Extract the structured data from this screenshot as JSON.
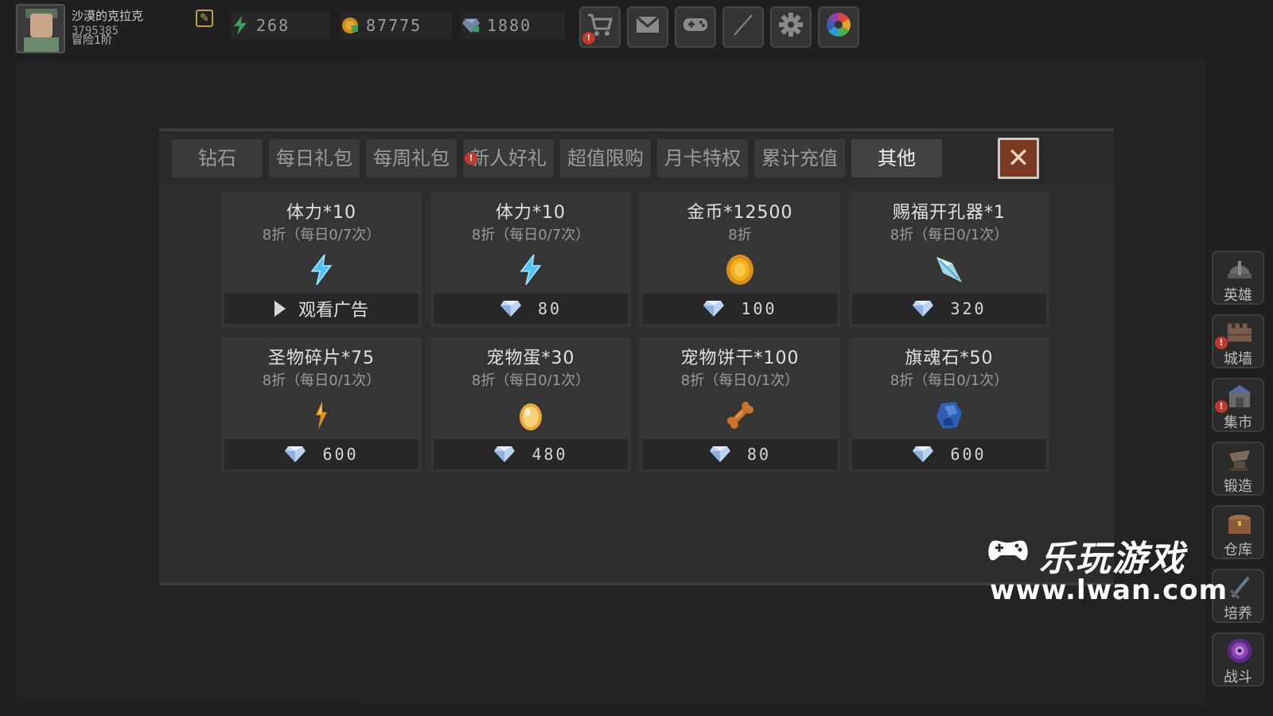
{
  "player": {
    "name": "沙漠的克拉克",
    "id": "3795385",
    "rank": "冒险1阶"
  },
  "resources": [
    {
      "icon": "lightning-icon",
      "value": "268"
    },
    {
      "icon": "gold-coin-icon",
      "value": "87775"
    },
    {
      "icon": "diamond-icon",
      "value": "1880"
    }
  ],
  "top_buttons": [
    {
      "icon": "shop-cart-icon",
      "alert": "!"
    },
    {
      "icon": "mail-icon"
    },
    {
      "icon": "gamepad-icon"
    },
    {
      "icon": "feather-icon"
    },
    {
      "icon": "gear-icon"
    },
    {
      "icon": "color-wheel-icon"
    }
  ],
  "shop": {
    "tabs": [
      {
        "label": "钻石"
      },
      {
        "label": "每日礼包"
      },
      {
        "label": "每周礼包"
      },
      {
        "label": "新人好礼",
        "alert": "!"
      },
      {
        "label": "超值限购"
      },
      {
        "label": "月卡特权"
      },
      {
        "label": "累计充值"
      },
      {
        "label": "其他",
        "active": true
      }
    ],
    "close_label": "✕",
    "items": [
      {
        "title": "体力*10",
        "subtitle": "8折（每日0/7次）",
        "icon": "lightning-icon",
        "price_type": "ad",
        "price_label": "观看广告"
      },
      {
        "title": "体力*10",
        "subtitle": "8折（每日0/7次）",
        "icon": "lightning-icon",
        "price_type": "diamond",
        "price": "80"
      },
      {
        "title": "金币*12500",
        "subtitle": "8折",
        "icon": "gold-coin-icon",
        "price_type": "diamond",
        "price": "100"
      },
      {
        "title": "赐福开孔器*1",
        "subtitle": "8折（每日0/1次）",
        "icon": "drill-icon",
        "price_type": "diamond",
        "price": "320"
      },
      {
        "title": "圣物碎片*75",
        "subtitle": "8折（每日0/1次）",
        "icon": "relic-shard-icon",
        "price_type": "diamond",
        "price": "600"
      },
      {
        "title": "宠物蛋*30",
        "subtitle": "8折（每日0/1次）",
        "icon": "pet-egg-icon",
        "price_type": "diamond",
        "price": "480"
      },
      {
        "title": "宠物饼干*100",
        "subtitle": "8折（每日0/1次）",
        "icon": "bone-biscuit-icon",
        "price_type": "diamond",
        "price": "80"
      },
      {
        "title": "旗魂石*50",
        "subtitle": "8折（每日0/1次）",
        "icon": "soul-stone-icon",
        "price_type": "diamond",
        "price": "600"
      }
    ]
  },
  "sidebar": [
    {
      "label": "英雄",
      "icon": "helmet-icon"
    },
    {
      "label": "城墙",
      "icon": "wall-icon",
      "alert": "!"
    },
    {
      "label": "集市",
      "icon": "market-icon",
      "alert": "!"
    },
    {
      "label": "锻造",
      "icon": "anvil-icon"
    },
    {
      "label": "仓库",
      "icon": "chest-icon"
    },
    {
      "label": "培养",
      "icon": "sword-icon"
    },
    {
      "label": "战斗",
      "icon": "portal-icon"
    }
  ],
  "watermark": {
    "brand": "乐玩游戏",
    "url": "www.lwan.com"
  },
  "colors": {
    "background": "#1f1f1f",
    "panel": "#2d2d2d",
    "card": "#353535",
    "close_button": "#7a3a22",
    "alert": "#c0392b",
    "diamond": "#bcd4f2",
    "lightning": "#4fc3f7",
    "gold": "#f2b01e"
  }
}
